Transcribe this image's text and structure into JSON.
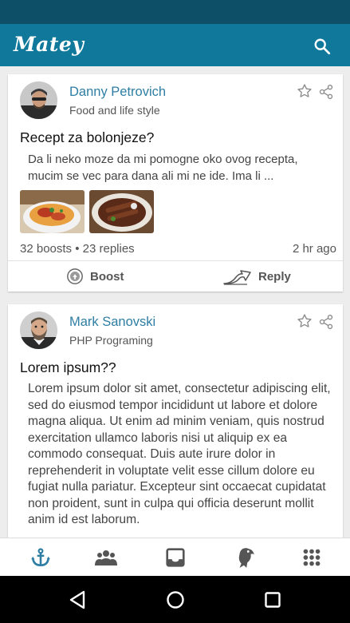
{
  "app": {
    "title": "Matey"
  },
  "posts": [
    {
      "author": "Danny Petrovich",
      "topic": "Food and life style",
      "title": "Recept za bolonjeze?",
      "body": "Da li neko moze da mi pomogne oko ovog recepta, mucim se vec para dana ali mi ne ide. Ima li ...",
      "stats": "32 boosts • 23 replies",
      "time": "2 hr ago",
      "boost_label": "Boost",
      "reply_label": "Reply"
    },
    {
      "author": "Mark Sanovski",
      "topic": "PHP Programing",
      "title": "Lorem ipsum??",
      "body": "Lorem ipsum dolor sit amet, consectetur adipiscing elit, sed do eiusmod tempor incididunt ut labore et dolore magna aliqua. Ut enim ad minim veniam, quis nostrud exercitation ullamco laboris nisi ut aliquip ex ea commodo consequat. Duis aute irure dolor in reprehenderit in voluptate velit esse cillum dolore eu fugiat nulla pariatur. Excepteur sint occaecat cupidatat non proident, sunt in culpa qui officia deserunt mollit anim id est laborum."
    }
  ],
  "bottom_nav": [
    {
      "icon": "anchor-icon",
      "active": true
    },
    {
      "icon": "group-icon",
      "active": false
    },
    {
      "icon": "inbox-icon",
      "active": false
    },
    {
      "icon": "parrot-icon",
      "active": false
    },
    {
      "icon": "apps-grid-icon",
      "active": false
    }
  ],
  "colors": {
    "status_bar": "#0d4f66",
    "app_bar": "#10789b",
    "accent": "#2e7ea3",
    "nav_active": "#2e7ea3",
    "nav_inactive": "#555555"
  }
}
